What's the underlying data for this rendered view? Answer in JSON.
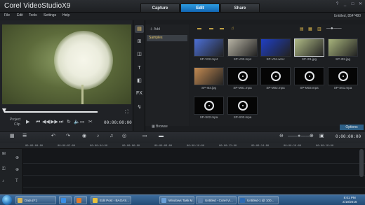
{
  "app": {
    "title_light": "Corel ",
    "title_bold": "VideoStudioX9",
    "project_info": "Untitled, 854*480"
  },
  "mode_tabs": [
    {
      "label": "Capture",
      "active": false
    },
    {
      "label": "Edit",
      "active": true
    },
    {
      "label": "Share",
      "active": false
    }
  ],
  "window_buttons": [
    "?",
    "_",
    "□",
    "✕"
  ],
  "menu": [
    "File",
    "Edit",
    "Tools",
    "Settings",
    "Help"
  ],
  "player": {
    "project_label": "Project",
    "clip_label": "Clip",
    "timecode": "00:00:00:00",
    "play_icon": "play-icon"
  },
  "library_toolbar": [
    {
      "name": "media-icon",
      "glyph": "▤"
    },
    {
      "name": "instant-project-icon",
      "glyph": "⊞"
    },
    {
      "name": "transition-icon",
      "glyph": "◫"
    },
    {
      "name": "title-icon",
      "glyph": "T"
    },
    {
      "name": "graphic-icon",
      "glyph": "◧"
    },
    {
      "name": "filter-icon",
      "glyph": "FX"
    },
    {
      "name": "path-icon",
      "glyph": "↯"
    }
  ],
  "library": {
    "add_label": "Add",
    "folder": "Samples",
    "browse_label": "Browse",
    "options_label": "Options",
    "items": [
      {
        "label": "SP-V02.mp4",
        "kind": "video",
        "color": "#4c6fd6"
      },
      {
        "label": "SP-V03.mp4",
        "kind": "video",
        "color": "#b7b3a4"
      },
      {
        "label": "SP-V04.wmv",
        "kind": "video",
        "color": "#1f3fc4"
      },
      {
        "label": "SP-I01.jpg",
        "kind": "image",
        "color": "#b0bb86",
        "selected": true
      },
      {
        "label": "SP-I02.jpg",
        "kind": "image",
        "color": "#a8b47c"
      },
      {
        "label": "SP-I03.jpg",
        "kind": "image",
        "color": "#c38a52"
      },
      {
        "label": "SP-M01.mpa",
        "kind": "audio"
      },
      {
        "label": "SP-M02.mpa",
        "kind": "audio"
      },
      {
        "label": "SP-M03.mpa",
        "kind": "audio"
      },
      {
        "label": "SP-S01.mpa",
        "kind": "audio"
      },
      {
        "label": "SP-S02.mpa",
        "kind": "audio"
      },
      {
        "label": "SP-S03.mpa",
        "kind": "audio"
      }
    ]
  },
  "timeline": {
    "ruler_labels": [
      "00:00:00:00",
      "00:00:02:00",
      "00:00:04:00",
      "00:00:06:00",
      "00:00:08:00",
      "00:00:10:00",
      "00:00:12:00",
      "00:00:14:00",
      "00:00:16:00",
      "00:00:18:00"
    ],
    "timecode": "0:00:00:00"
  },
  "taskbar": {
    "buttons": [
      {
        "label": "Data (F:)",
        "color": "#d8b75a"
      },
      {
        "label": "",
        "color": "#3a8ee6"
      },
      {
        "label": "",
        "color": "#e07b2a"
      },
      {
        "label": "Edit Post ‹ BAGAS...",
        "color": "#e9c13c"
      },
      {
        "label": "Windows Task M...",
        "color": "#6aa0d8"
      },
      {
        "label": "Untitled - Corel Vi...",
        "color": "#5a7ea8"
      },
      {
        "label": "Untitled-1 @ 100...",
        "color": "#2e6bb3"
      }
    ],
    "time": "8:01 PM",
    "date": "2/18/2016"
  }
}
